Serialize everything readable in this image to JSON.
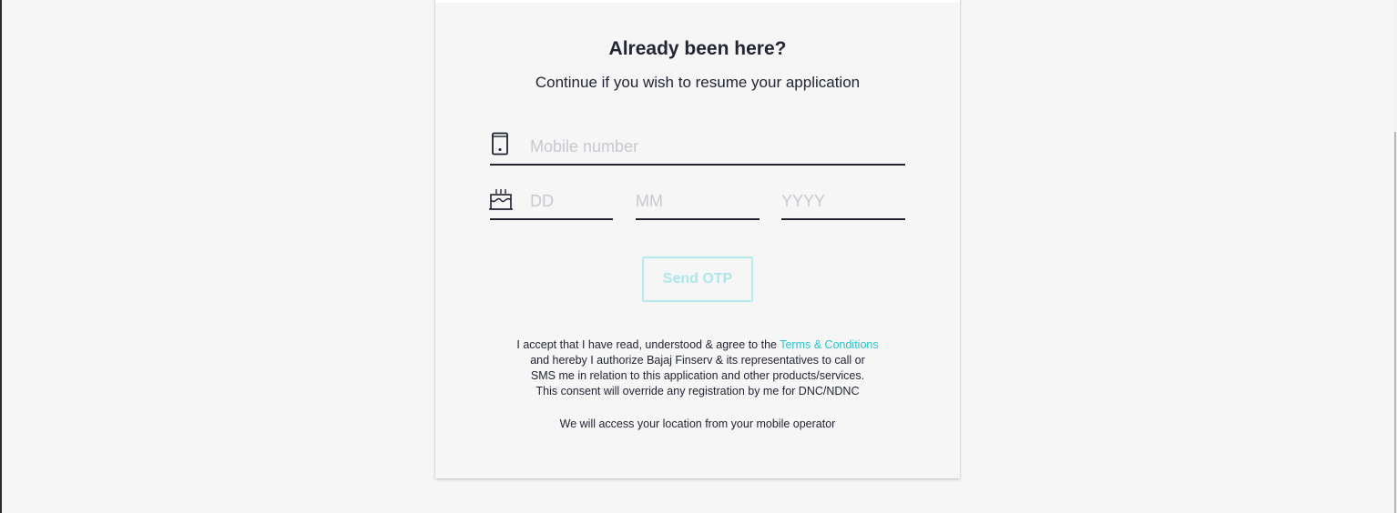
{
  "form": {
    "title": "Already been here?",
    "subtitle": "Continue if you wish to resume your application",
    "mobile": {
      "placeholder": "Mobile number",
      "icon": "mobile-phone-icon"
    },
    "dob": {
      "icon": "birthday-cake-icon",
      "day_placeholder": "DD",
      "month_placeholder": "MM",
      "year_placeholder": "YYYY"
    },
    "send_otp_label": "Send OTP",
    "consent": {
      "line1_prefix": "I accept that I have read, understood & agree to the ",
      "terms_link": "Terms & Conditions",
      "line2": "and hereby I authorize Bajaj Finserv & its representatives to call or",
      "line3": "SMS me in relation to this application and other products/services.",
      "line4": "This consent will override any registration by me for DNC/NDNC"
    },
    "location_note": "We will access your location from your mobile operator"
  },
  "colors": {
    "page_background": "#f6f6f6",
    "text": "#222533",
    "accent": "#28c4c8",
    "button_disabled_border": "#b4ecef",
    "placeholder": "#c6c9d0"
  }
}
